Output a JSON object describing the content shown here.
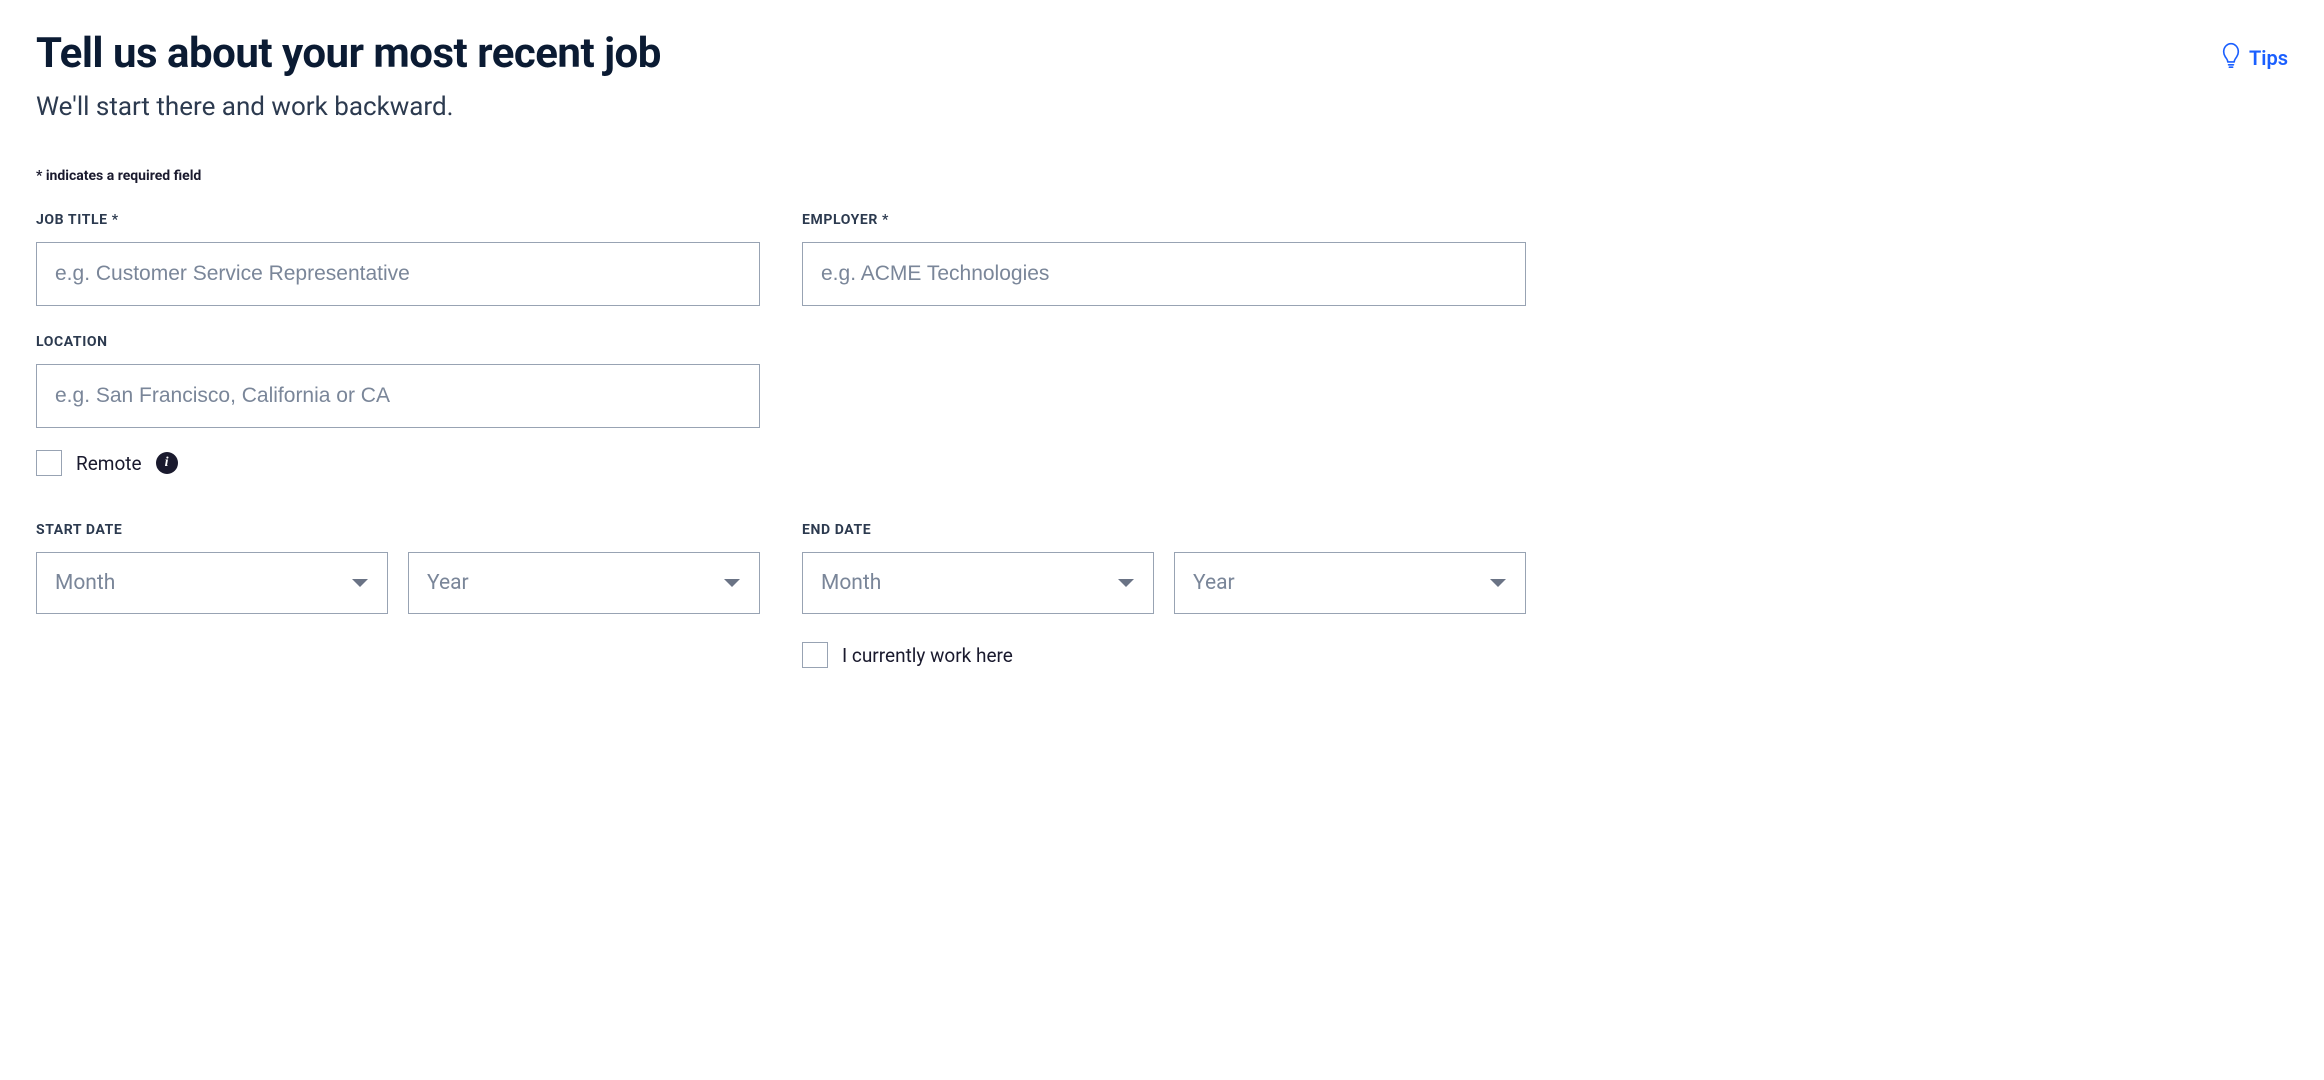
{
  "header": {
    "title": "Tell us about your most recent job",
    "subtitle": "We'll start there and work backward.",
    "tips_label": "Tips"
  },
  "required_note": "* indicates a required field",
  "fields": {
    "job_title": {
      "label": "JOB TITLE *",
      "placeholder": "e.g. Customer Service Representative",
      "value": ""
    },
    "employer": {
      "label": "EMPLOYER *",
      "placeholder": "e.g. ACME Technologies",
      "value": ""
    },
    "location": {
      "label": "LOCATION",
      "placeholder": "e.g. San Francisco, California or CA",
      "value": ""
    },
    "remote": {
      "label": "Remote",
      "checked": false
    },
    "start_date": {
      "label": "START DATE",
      "month_placeholder": "Month",
      "year_placeholder": "Year"
    },
    "end_date": {
      "label": "END DATE",
      "month_placeholder": "Month",
      "year_placeholder": "Year"
    },
    "current": {
      "label": "I currently work here",
      "checked": false
    }
  }
}
